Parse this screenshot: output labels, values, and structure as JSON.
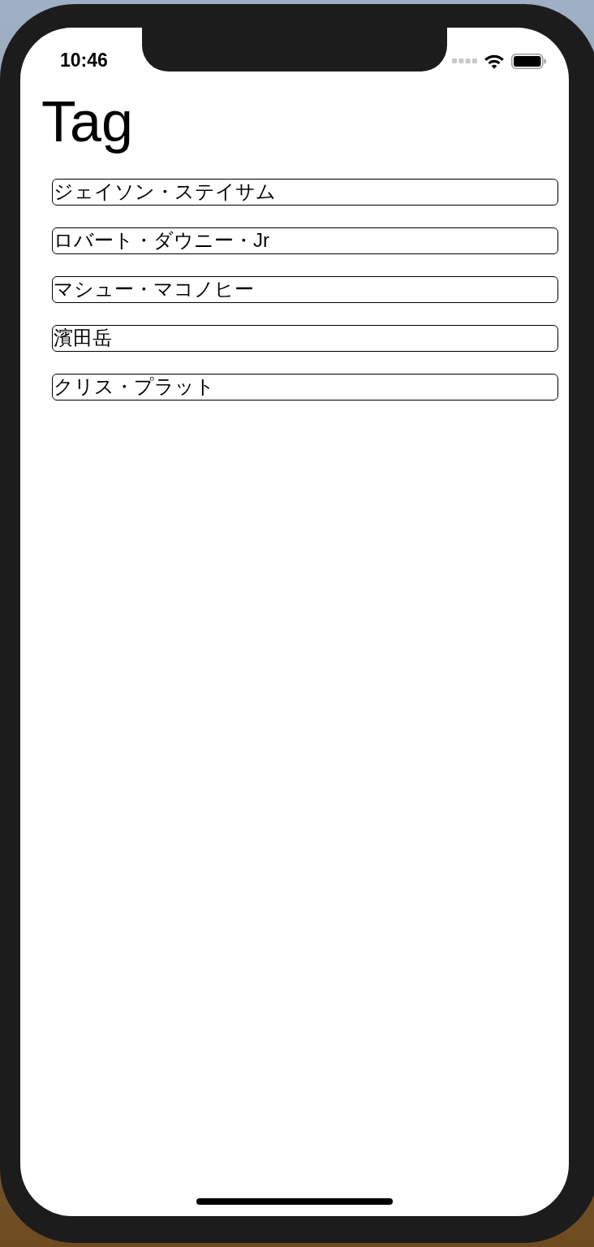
{
  "status_bar": {
    "time": "10:46"
  },
  "title": "Tag",
  "tags": [
    {
      "label": "ジェイソン・ステイサム"
    },
    {
      "label": "ロバート・ダウニー・Jr"
    },
    {
      "label": "マシュー・マコノヒー"
    },
    {
      "label": "濱田岳"
    },
    {
      "label": "クリス・プラット"
    }
  ]
}
